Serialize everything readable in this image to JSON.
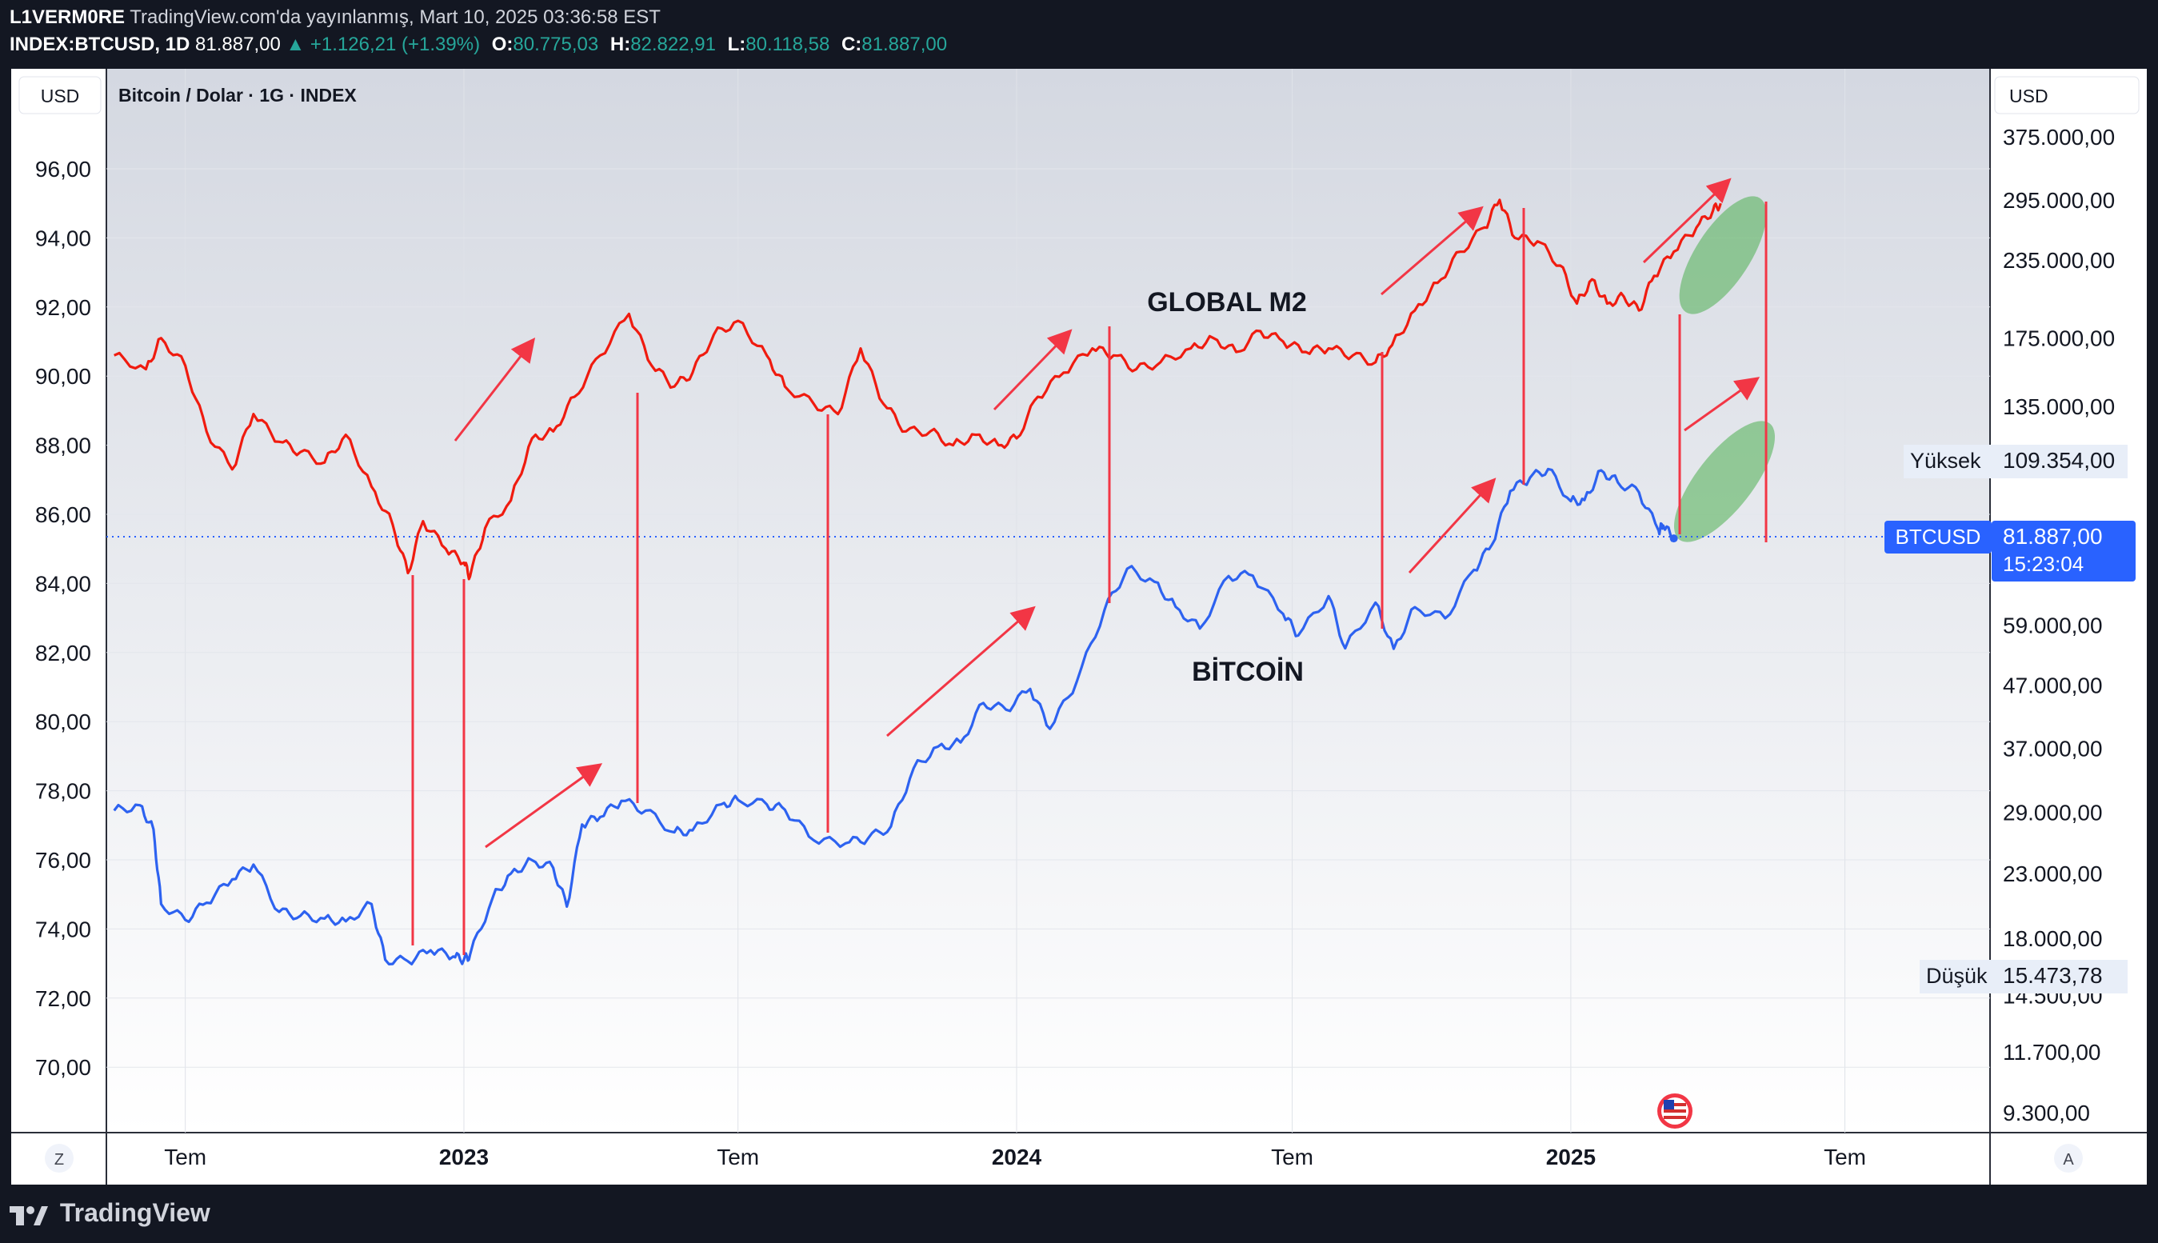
{
  "header": {
    "author": "L1VERM0RE",
    "published_text": "TradingView.com'da yayınlanmış, Mart 10, 2025 03:36:58 EST",
    "symbol": "INDEX:BTCUSD, 1D",
    "last": "81.887,00",
    "change": "▲ +1.126,21 (+1.39%)",
    "o_label": "O:",
    "o_value": "80.775,03",
    "h_label": "H:",
    "h_value": "82.822,91",
    "l_label": "L:",
    "l_value": "80.118,58",
    "c_label": "C:",
    "c_value": "81.887,00"
  },
  "chart_header": {
    "left_currency": "USD",
    "right_currency": "USD",
    "title": "Bitcoin / Dolar · 1G · INDEX"
  },
  "annotations": {
    "m2_label": "GLOBAL M2",
    "btc_label": "BİTCOİN"
  },
  "price_labels": {
    "high_label": "Yüksek",
    "high_value": "109.354,00",
    "low_label": "Düşük",
    "low_value": "15.473,78",
    "current_symbol": "BTCUSD",
    "current_value": "81.887,00",
    "countdown": "15:23:04"
  },
  "bottom": {
    "left_button": "Z",
    "right_button": "A"
  },
  "footer": {
    "brand": "TradingView"
  },
  "colors": {
    "m2_line": "#f01b0f",
    "btc_line": "#2d62f0",
    "annotation_red": "#f23645",
    "highlight_green": "#4caf50",
    "current_price_tag": "#2962ff"
  },
  "chart_data": {
    "type": "line",
    "title": "Bitcoin / Dolar · 1G · INDEX",
    "x_ticks": [
      "Tem",
      "2023",
      "Tem",
      "2024",
      "Tem",
      "2025",
      "Tem"
    ],
    "x_tick_dates": [
      "2022-07-01",
      "2023-01-01",
      "2023-07-01",
      "2024-01-01",
      "2024-07-01",
      "2025-01-01",
      "2025-07-01"
    ],
    "left_axis": {
      "unit": "USD",
      "ticks": [
        "96,00",
        "94,00",
        "92,00",
        "90,00",
        "88,00",
        "86,00",
        "84,00",
        "82,00",
        "80,00",
        "78,00",
        "76,00",
        "74,00",
        "72,00",
        "70,00"
      ],
      "tick_values": [
        96,
        94,
        92,
        90,
        88,
        86,
        84,
        82,
        80,
        78,
        76,
        74,
        72,
        70
      ],
      "range": [
        68.1,
        98.7
      ]
    },
    "right_axis": {
      "unit": "USD",
      "scale": "log",
      "ticks": [
        "375.000,00",
        "295.000,00",
        "235.000,00",
        "175.000,00",
        "135.000,00",
        "109.354,00",
        "81.887,00",
        "59.000,00",
        "47.000,00",
        "37.000,00",
        "29.000,00",
        "23.000,00",
        "18.000,00",
        "14.500,00",
        "11.700,00",
        "9.300,00"
      ],
      "tick_values": [
        375000,
        295000,
        235000,
        175000,
        135000,
        109354,
        81887,
        59000,
        47000,
        37000,
        29000,
        23000,
        18000,
        14500,
        11700,
        9300
      ]
    },
    "series": [
      {
        "name": "GLOBAL M2",
        "axis": "left",
        "points": [
          [
            "2022-05-15",
            90.6
          ],
          [
            "2022-06-05",
            90.2
          ],
          [
            "2022-06-15",
            91.1
          ],
          [
            "2022-07-01",
            90.3
          ],
          [
            "2022-07-15",
            88.4
          ],
          [
            "2022-08-01",
            87.3
          ],
          [
            "2022-08-15",
            88.9
          ],
          [
            "2022-09-01",
            88.1
          ],
          [
            "2022-09-15",
            87.8
          ],
          [
            "2022-10-01",
            87.5
          ],
          [
            "2022-10-15",
            88.3
          ],
          [
            "2022-11-01",
            86.8
          ],
          [
            "2022-11-15",
            85.7
          ],
          [
            "2022-11-25",
            84.3
          ],
          [
            "2022-12-05",
            85.8
          ],
          [
            "2022-12-20",
            85.0
          ],
          [
            "2023-01-01",
            84.6
          ],
          [
            "2023-01-05",
            84.2
          ],
          [
            "2023-01-15",
            85.6
          ],
          [
            "2023-02-01",
            86.4
          ],
          [
            "2023-02-15",
            88.2
          ],
          [
            "2023-03-01",
            88.4
          ],
          [
            "2023-03-15",
            89.4
          ],
          [
            "2023-04-01",
            90.6
          ],
          [
            "2023-04-20",
            91.8
          ],
          [
            "2023-05-05",
            90.3
          ],
          [
            "2023-05-20",
            89.7
          ],
          [
            "2023-06-01",
            90.1
          ],
          [
            "2023-06-15",
            91.2
          ],
          [
            "2023-07-01",
            91.6
          ],
          [
            "2023-07-20",
            90.6
          ],
          [
            "2023-08-01",
            89.7
          ],
          [
            "2023-08-20",
            89.2
          ],
          [
            "2023-09-05",
            88.9
          ],
          [
            "2023-09-20",
            90.8
          ],
          [
            "2023-10-05",
            89.2
          ],
          [
            "2023-10-20",
            88.4
          ],
          [
            "2023-11-05",
            88.4
          ],
          [
            "2023-11-20",
            88.0
          ],
          [
            "2023-12-05",
            88.3
          ],
          [
            "2023-12-20",
            88.0
          ],
          [
            "2024-01-01",
            88.2
          ],
          [
            "2024-01-15",
            89.4
          ],
          [
            "2024-02-01",
            90.1
          ],
          [
            "2024-02-20",
            90.8
          ],
          [
            "2024-03-05",
            90.6
          ],
          [
            "2024-03-20",
            90.2
          ],
          [
            "2024-04-05",
            90.4
          ],
          [
            "2024-04-25",
            90.8
          ],
          [
            "2024-05-10",
            91.1
          ],
          [
            "2024-05-25",
            90.7
          ],
          [
            "2024-06-10",
            91.3
          ],
          [
            "2024-06-25",
            91.0
          ],
          [
            "2024-07-10",
            90.7
          ],
          [
            "2024-07-25",
            90.8
          ],
          [
            "2024-08-10",
            90.6
          ],
          [
            "2024-08-25",
            90.4
          ],
          [
            "2024-09-05",
            90.9
          ],
          [
            "2024-09-20",
            91.9
          ],
          [
            "2024-10-05",
            92.7
          ],
          [
            "2024-10-20",
            93.6
          ],
          [
            "2024-11-05",
            94.3
          ],
          [
            "2024-11-15",
            95.1
          ],
          [
            "2024-11-25",
            94.0
          ],
          [
            "2024-12-10",
            93.9
          ],
          [
            "2024-12-25",
            93.2
          ],
          [
            "2025-01-05",
            92.1
          ],
          [
            "2025-01-15",
            92.8
          ],
          [
            "2025-01-25",
            92.1
          ],
          [
            "2025-02-05",
            92.3
          ],
          [
            "2025-02-15",
            91.9
          ],
          [
            "2025-02-25",
            92.9
          ],
          [
            "2025-03-10",
            93.6
          ],
          [
            "2025-03-25",
            94.3
          ],
          [
            "2025-04-05",
            94.8
          ],
          [
            "2025-04-10",
            95.0
          ]
        ]
      },
      {
        "name": "BİTCOİN",
        "axis": "right",
        "points": [
          [
            "2022-05-15",
            29200
          ],
          [
            "2022-06-01",
            29800
          ],
          [
            "2022-06-10",
            27200
          ],
          [
            "2022-06-15",
            20500
          ],
          [
            "2022-07-01",
            19300
          ],
          [
            "2022-07-15",
            20600
          ],
          [
            "2022-08-01",
            22500
          ],
          [
            "2022-08-15",
            23800
          ],
          [
            "2022-09-01",
            19900
          ],
          [
            "2022-09-15",
            19600
          ],
          [
            "2022-10-01",
            19400
          ],
          [
            "2022-10-15",
            19200
          ],
          [
            "2022-11-01",
            20500
          ],
          [
            "2022-11-10",
            16600
          ],
          [
            "2022-11-25",
            16500
          ],
          [
            "2022-12-10",
            17200
          ],
          [
            "2022-12-25",
            16800
          ],
          [
            "2023-01-01",
            16600
          ],
          [
            "2023-01-05",
            16900
          ],
          [
            "2023-01-20",
            21000
          ],
          [
            "2023-02-01",
            23000
          ],
          [
            "2023-02-15",
            24200
          ],
          [
            "2023-03-01",
            23500
          ],
          [
            "2023-03-10",
            20300
          ],
          [
            "2023-03-20",
            27700
          ],
          [
            "2023-04-01",
            28500
          ],
          [
            "2023-04-15",
            30300
          ],
          [
            "2023-05-01",
            29200
          ],
          [
            "2023-05-20",
            26900
          ],
          [
            "2023-06-01",
            27100
          ],
          [
            "2023-06-20",
            29900
          ],
          [
            "2023-07-01",
            30400
          ],
          [
            "2023-07-20",
            29900
          ],
          [
            "2023-08-01",
            29300
          ],
          [
            "2023-08-20",
            26100
          ],
          [
            "2023-09-10",
            25800
          ],
          [
            "2023-09-25",
            26300
          ],
          [
            "2023-10-10",
            27500
          ],
          [
            "2023-10-25",
            34300
          ],
          [
            "2023-11-10",
            37200
          ],
          [
            "2023-11-25",
            37800
          ],
          [
            "2023-12-10",
            43900
          ],
          [
            "2023-12-25",
            42800
          ],
          [
            "2024-01-10",
            46300
          ],
          [
            "2024-01-23",
            39800
          ],
          [
            "2024-02-10",
            47800
          ],
          [
            "2024-02-28",
            62400
          ],
          [
            "2024-03-14",
            73000
          ],
          [
            "2024-04-01",
            69500
          ],
          [
            "2024-04-15",
            63200
          ],
          [
            "2024-05-01",
            58200
          ],
          [
            "2024-05-20",
            71000
          ],
          [
            "2024-06-05",
            71100
          ],
          [
            "2024-06-25",
            61500
          ],
          [
            "2024-07-05",
            56700
          ],
          [
            "2024-07-25",
            65800
          ],
          [
            "2024-08-05",
            54000
          ],
          [
            "2024-08-25",
            64200
          ],
          [
            "2024-09-06",
            53900
          ],
          [
            "2024-09-20",
            63100
          ],
          [
            "2024-10-10",
            60500
          ],
          [
            "2024-10-29",
            72700
          ],
          [
            "2024-11-10",
            80000
          ],
          [
            "2024-11-22",
            98000
          ],
          [
            "2024-12-05",
            103000
          ],
          [
            "2024-12-17",
            106500
          ],
          [
            "2025-01-01",
            94300
          ],
          [
            "2025-01-10",
            94700
          ],
          [
            "2025-01-21",
            106000
          ],
          [
            "2025-02-01",
            101300
          ],
          [
            "2025-02-15",
            97500
          ],
          [
            "2025-02-28",
            84300
          ],
          [
            "2025-03-03",
            86000
          ],
          [
            "2025-03-10",
            81887
          ]
        ]
      }
    ],
    "drawings": [
      "red arrows marking parallel up-moves of both series",
      "red vertical lines linking matching turning points",
      "green ellipse highlight over M2 rise and projected Bitcoin rise"
    ]
  }
}
